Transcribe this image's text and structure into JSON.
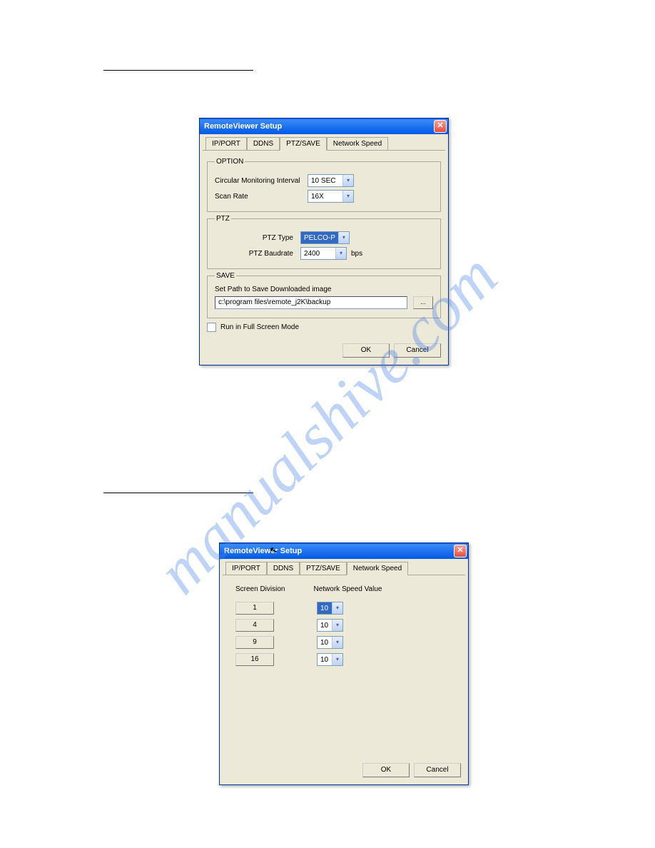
{
  "dialog1": {
    "title": "RemoteViewer Setup",
    "tabs": [
      "IP/PORT",
      "DDNS",
      "PTZ/SAVE",
      "Network Speed"
    ],
    "active_tab": "PTZ/SAVE",
    "option": {
      "legend": "OPTION",
      "cm_label": "Circular Monitoring Interval",
      "cm_value": "10 SEC",
      "sr_label": "Scan Rate",
      "sr_value": "16X"
    },
    "ptz": {
      "legend": "PTZ",
      "type_label": "PTZ Type",
      "type_value": "PELCO-P",
      "baud_label": "PTZ Baudrate",
      "baud_value": "2400",
      "baud_unit": "bps"
    },
    "save": {
      "legend": "SAVE",
      "path_label": "Set Path to Save Downloaded image",
      "path_value": "c:\\program files\\remote_j2K\\backup",
      "browse": "..."
    },
    "fullscreen": "Run in Full Screen Mode",
    "ok": "OK",
    "cancel": "Cancel"
  },
  "dialog2": {
    "title": "RemoteViewer Setup",
    "tabs": [
      "IP/PORT",
      "DDNS",
      "PTZ/SAVE",
      "Network Speed"
    ],
    "active_tab": "Network Speed",
    "col1_header": "Screen Division",
    "col2_header": "Network Speed Value",
    "rows": [
      {
        "div": "1",
        "val": "10"
      },
      {
        "div": "4",
        "val": "10"
      },
      {
        "div": "9",
        "val": "10"
      },
      {
        "div": "16",
        "val": "10"
      }
    ],
    "ok": "OK",
    "cancel": "Cancel"
  }
}
